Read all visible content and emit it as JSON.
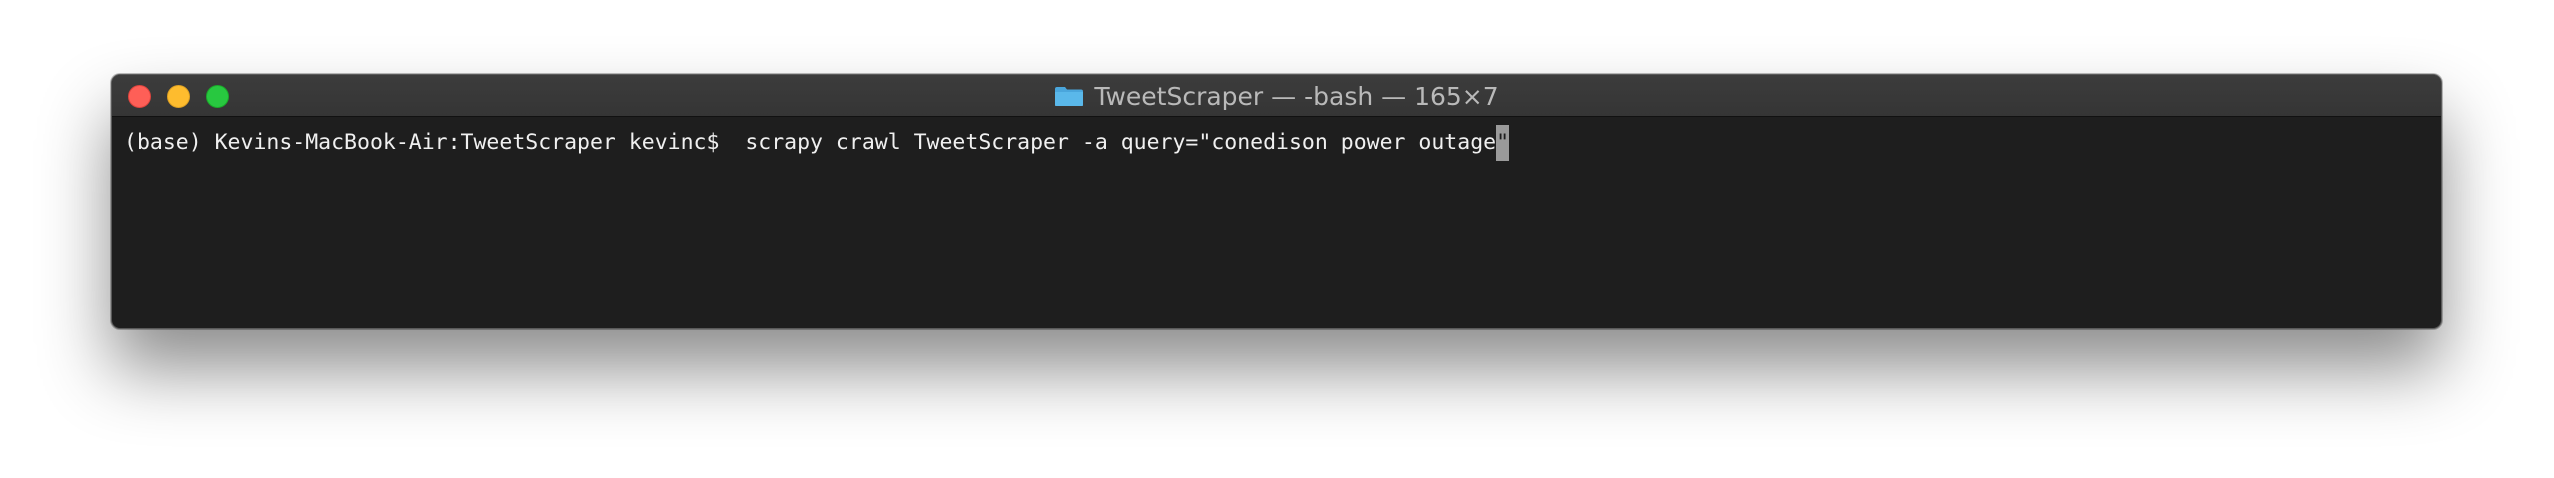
{
  "window": {
    "title": "TweetScraper — -bash — 165×7"
  },
  "terminal": {
    "prompt": "(base) Kevins-MacBook-Air:TweetScraper kevinc$  ",
    "command": "scrapy crawl TweetScraper -a query=\"conedison power outage",
    "cursor_char": "\""
  },
  "colors": {
    "close": "#fe5f57",
    "minimize": "#febc2e",
    "zoom": "#28c840",
    "folder": "#5ab2e4",
    "background": "#1e1e1e",
    "text": "#f0f0f0"
  },
  "icons": {
    "title": "folder-icon"
  }
}
